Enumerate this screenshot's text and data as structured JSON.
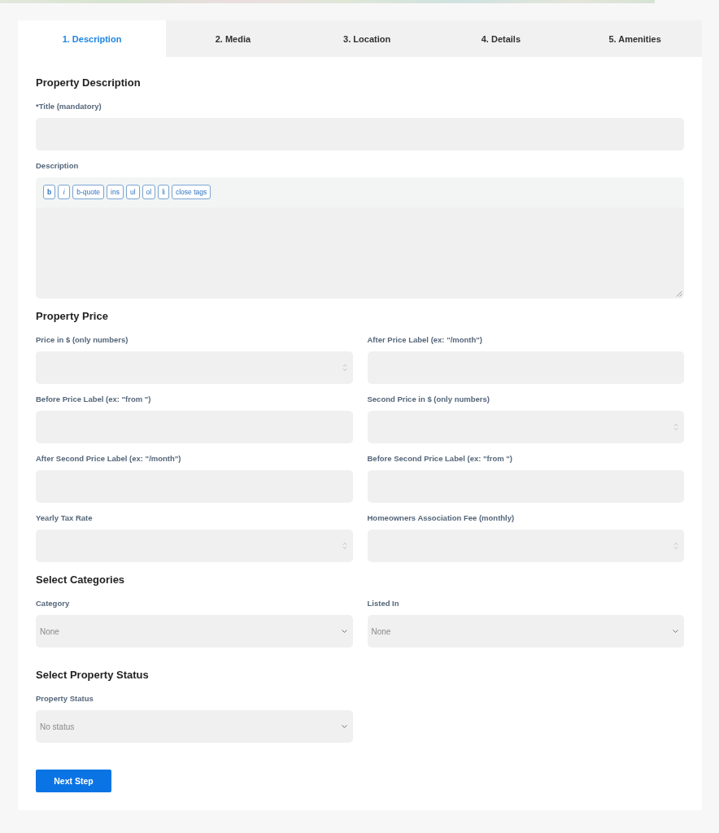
{
  "tabs": [
    {
      "label": "1. Description",
      "selected": true
    },
    {
      "label": "2. Media",
      "selected": false
    },
    {
      "label": "3. Location",
      "selected": false
    },
    {
      "label": "4. Details",
      "selected": false
    },
    {
      "label": "5. Amenities",
      "selected": false
    }
  ],
  "sections": [
    {
      "title": "Property Description",
      "kind": "stacked",
      "fields": [
        {
          "kind": "text",
          "label": "*Title (mandatory)"
        },
        {
          "kind": "editor",
          "label": "Description",
          "toolbar": [
            {
              "label": "b",
              "kind": "bold"
            },
            {
              "label": "i",
              "kind": "italic"
            },
            {
              "label": "b-quote",
              "kind": "plain"
            },
            {
              "label": "ins",
              "kind": "plain"
            },
            {
              "label": "ul",
              "kind": "plain"
            },
            {
              "label": "ol",
              "kind": "plain"
            },
            {
              "label": "li",
              "kind": "plain"
            },
            {
              "label": "close tags",
              "kind": "plain"
            }
          ]
        }
      ]
    },
    {
      "title": "Property Price",
      "kind": "columns",
      "fields": [
        {
          "kind": "number",
          "label": "Price in $ (only numbers)"
        },
        {
          "kind": "text",
          "label": "After Price Label (ex: \"/month\")"
        },
        {
          "kind": "text",
          "label": "Before Price Label (ex: \"from \")"
        },
        {
          "kind": "number",
          "label": "Second Price in $ (only numbers)"
        },
        {
          "kind": "text",
          "label": "After Second Price Label (ex: \"/month\")"
        },
        {
          "kind": "text",
          "label": "Before Second Price Label (ex: \"from \")"
        },
        {
          "kind": "number",
          "label": "Yearly Tax Rate"
        },
        {
          "kind": "number",
          "label": "Homeowners Association Fee (monthly)"
        }
      ]
    },
    {
      "title": "Select Categories",
      "kind": "columns",
      "fields": [
        {
          "kind": "select",
          "label": "Category",
          "value": "None"
        },
        {
          "kind": "select",
          "label": "Listed In",
          "value": "None"
        }
      ]
    },
    {
      "title": "Select Property Status",
      "kind": "columns",
      "fields": [
        {
          "kind": "select",
          "label": "Property Status",
          "value": "No status"
        }
      ]
    }
  ],
  "next_button": {
    "label": "Next Step"
  }
}
